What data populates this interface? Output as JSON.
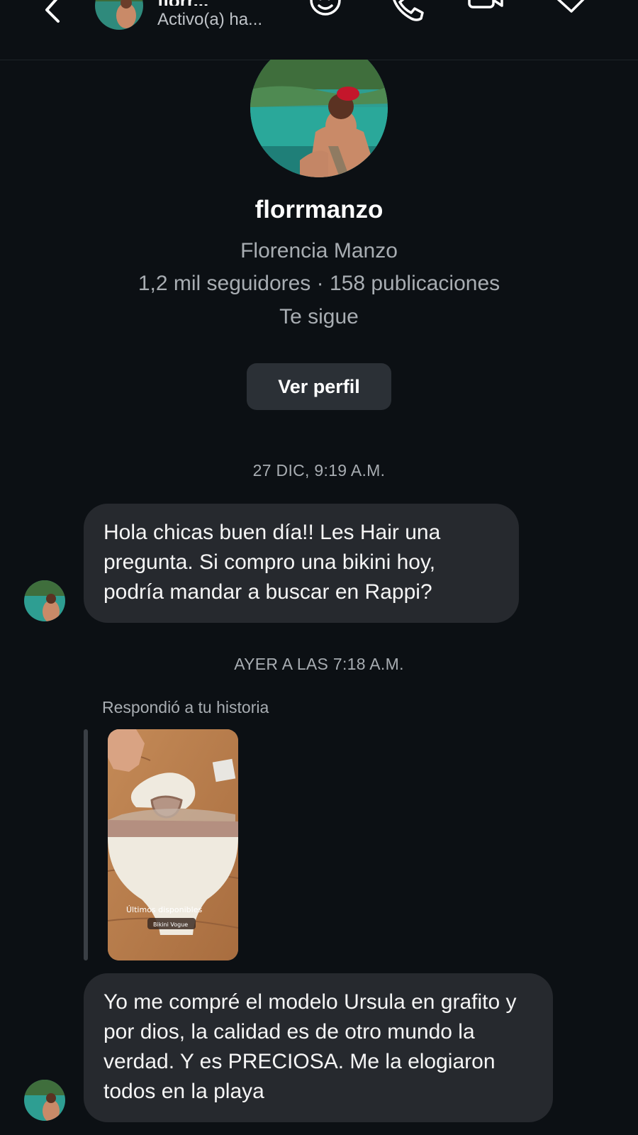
{
  "header": {
    "name": "florr...",
    "status": "Activo(a) ha...",
    "icons": [
      "back-arrow-icon",
      "sticker-icon",
      "phone-icon",
      "video-camera-icon",
      "tag-icon"
    ]
  },
  "profile": {
    "username": "florrmanzo",
    "full_name": "Florencia Manzo",
    "stats": "1,2 mil seguidores · 158 publicaciones",
    "follows_you": "Te sigue",
    "view_profile_label": "Ver perfil"
  },
  "messages": {
    "ts1": "27 DIC, 9:19 A.M.",
    "msg1": "Hola chicas buen día!! Les Hair una pregunta. Si compro una bikini hoy, podría mandar a buscar en Rappi?",
    "ts2": "AYER A LAS 7:18 A.M.",
    "reply_label": "Respondió a tu historia",
    "story_caption": "Últimos disponibles",
    "story_tag": "Bikini Vogue",
    "msg2": "Yo me compré el modelo Ursula en grafito y por dios, la calidad es de otro mundo la verdad. Y es PRECIOSA. Me la elogiaron todos en la playa"
  },
  "colors": {
    "background": "#0c1014",
    "bubble": "#26292e",
    "button": "#2b3036",
    "secondary_text": "#a8adb2"
  }
}
